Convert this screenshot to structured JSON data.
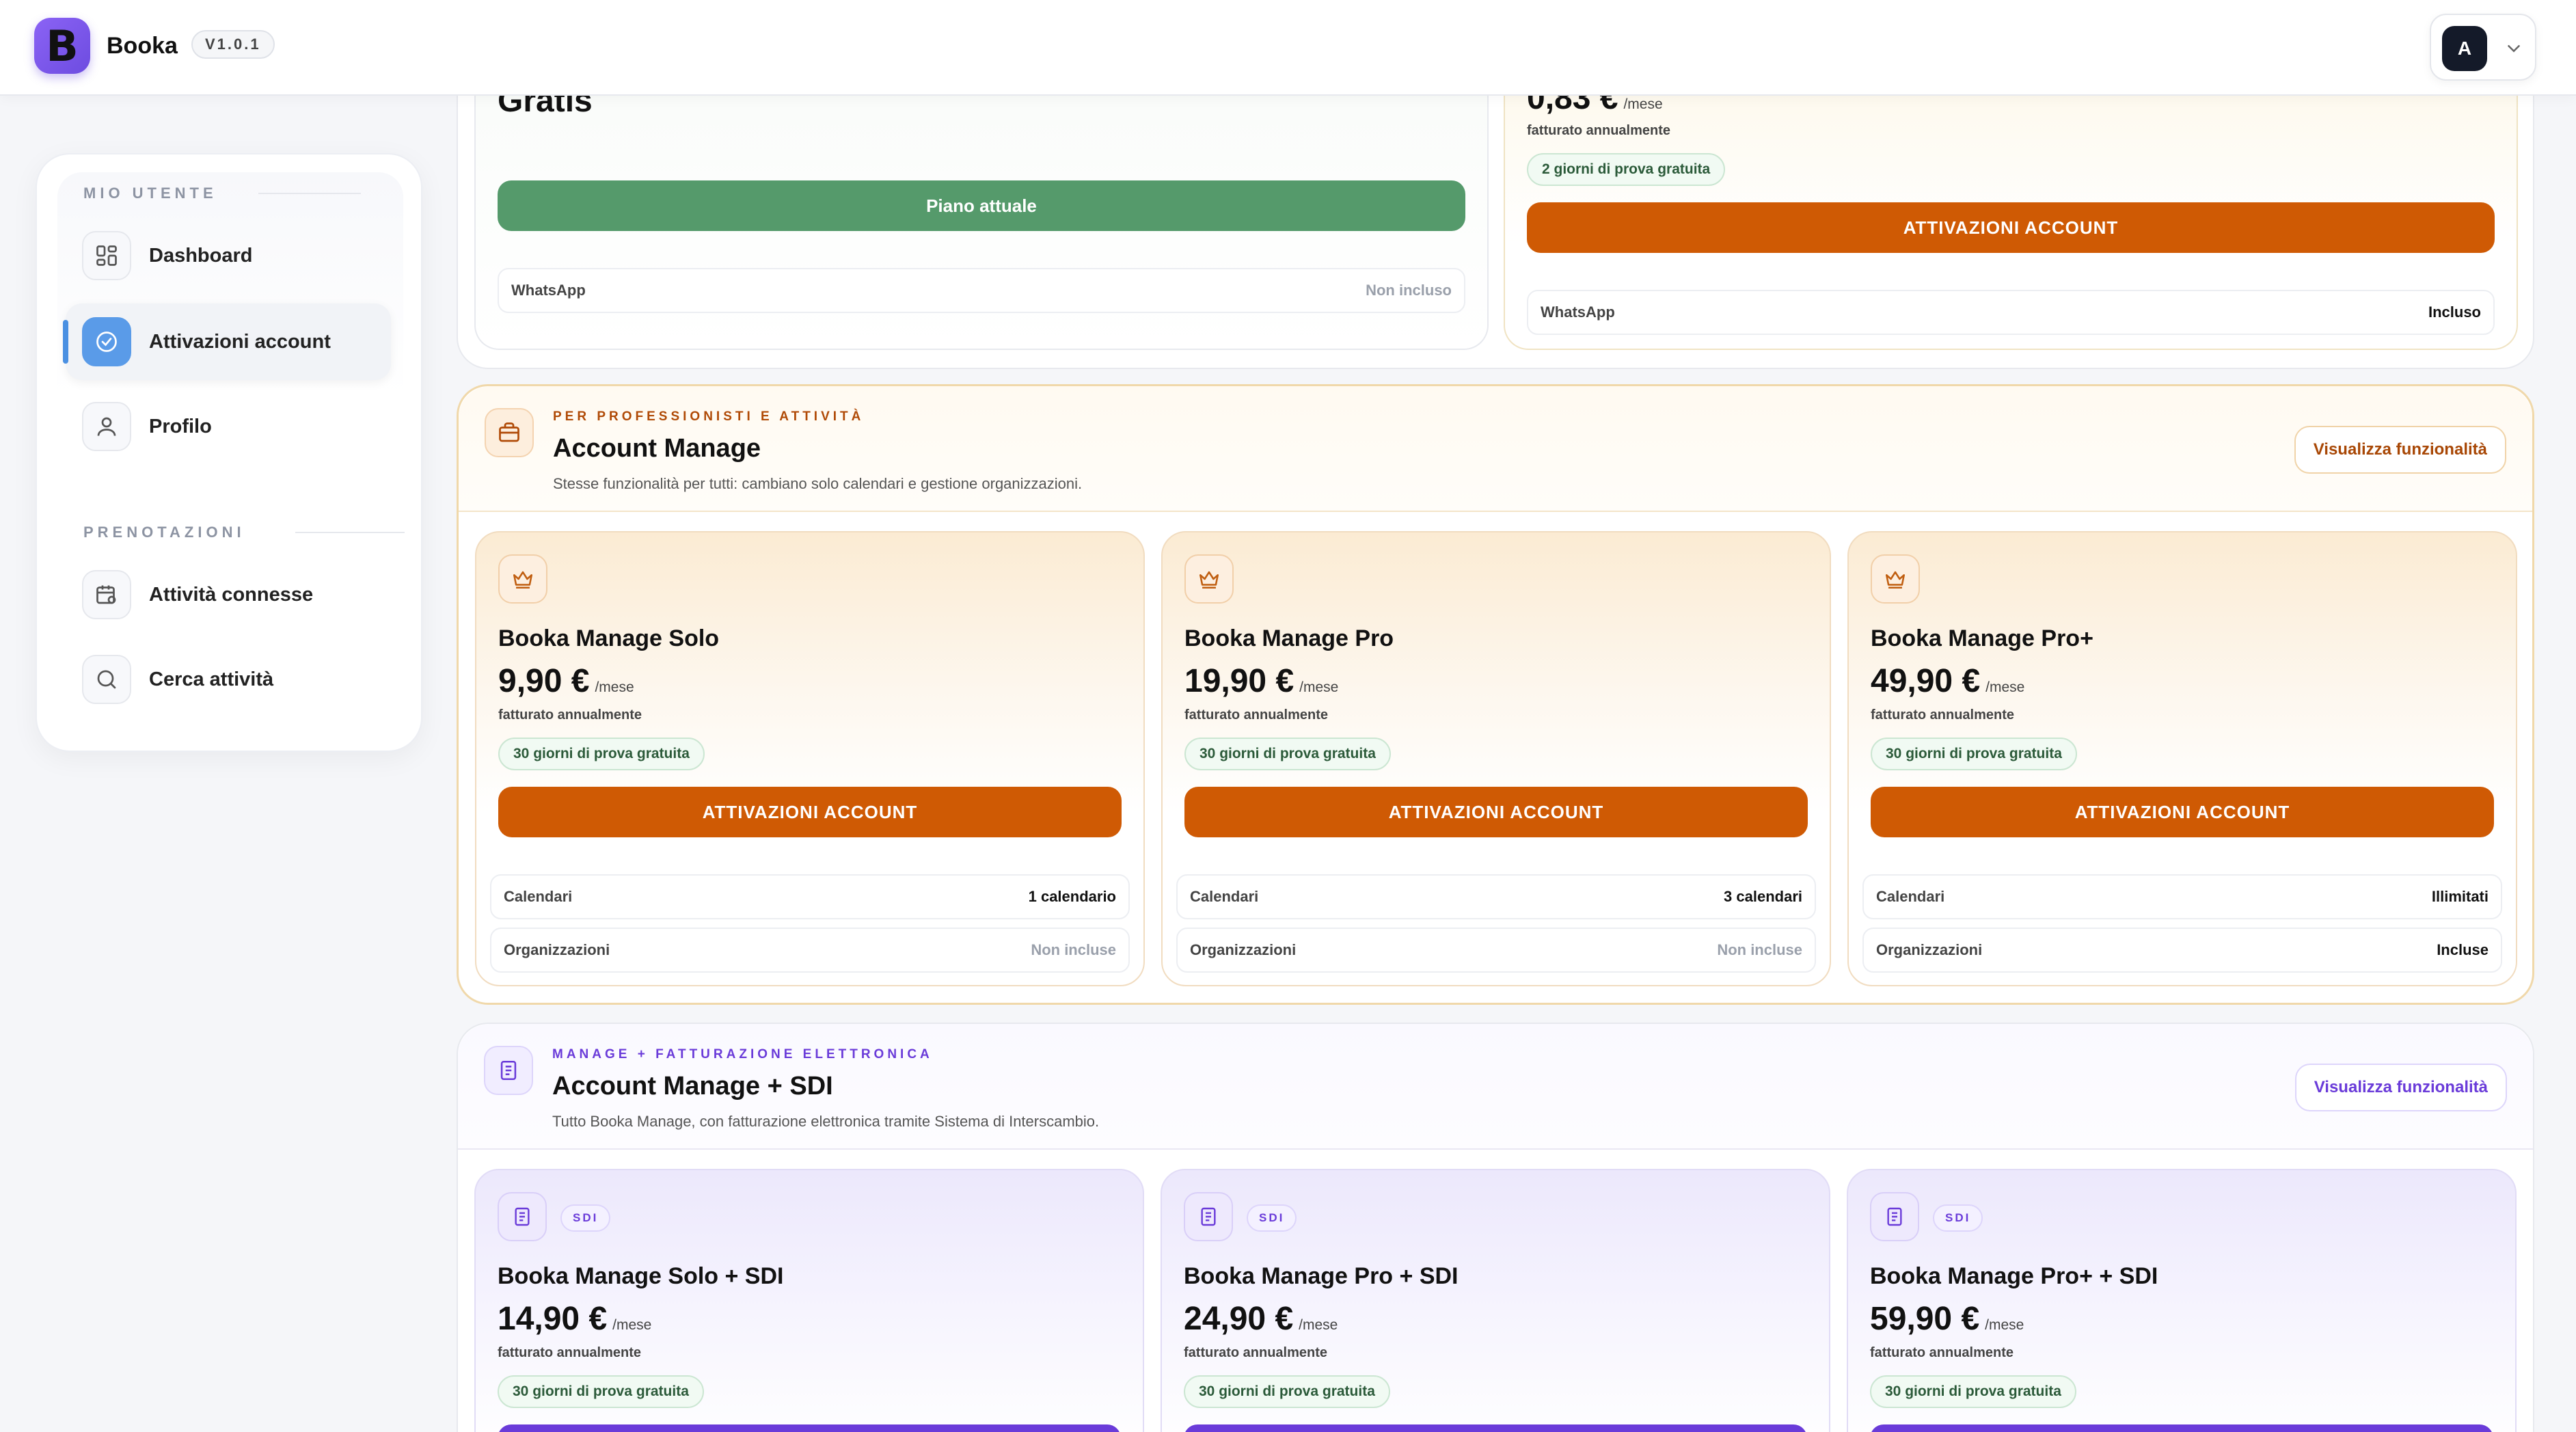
{
  "app": {
    "name": "Booka",
    "version": "V1.0.1",
    "logo_letter": "B"
  },
  "user": {
    "avatar_initial": "A"
  },
  "sidebar": {
    "section_user": "MIO UTENTE",
    "section_bookings": "PRENOTAZIONI",
    "items": [
      {
        "label": "Dashboard",
        "icon": "grid-icon"
      },
      {
        "label": "Attivazioni account",
        "icon": "check-circle-icon",
        "active": true
      },
      {
        "label": "Profilo",
        "icon": "user-icon"
      },
      {
        "label": "Attività connesse",
        "icon": "calendar-link-icon"
      },
      {
        "label": "Cerca attività",
        "icon": "search-icon"
      }
    ]
  },
  "top_plans": {
    "free": {
      "title": "Gratis",
      "button": "Piano attuale",
      "feature": {
        "key": "WhatsApp",
        "value": "Non incluso"
      }
    },
    "paid": {
      "price": "0,83 €",
      "per": "/mese",
      "billing": "fatturato annualmente",
      "trial": "2 giorni di prova gratuita",
      "button": "ATTIVAZIONI ACCOUNT",
      "feature": {
        "key": "WhatsApp",
        "value": "Incluso"
      }
    }
  },
  "manage": {
    "eyebrow": "PER PROFESSIONISTI E ATTIVITÀ",
    "title": "Account Manage",
    "desc": "Stesse funzionalità per tutti: cambiano solo calendari e gestione organizzazioni.",
    "view_button": "Visualizza funzionalità",
    "plans": [
      {
        "name": "Booka Manage Solo",
        "price": "9,90 €",
        "per": "/mese",
        "billing": "fatturato annualmente",
        "trial": "30 giorni di prova gratuita",
        "button": "ATTIVAZIONI ACCOUNT",
        "features": [
          {
            "key": "Calendari",
            "value": "1 calendario",
            "muted": false
          },
          {
            "key": "Organizzazioni",
            "value": "Non incluse",
            "muted": true
          }
        ]
      },
      {
        "name": "Booka Manage Pro",
        "price": "19,90 €",
        "per": "/mese",
        "billing": "fatturato annualmente",
        "trial": "30 giorni di prova gratuita",
        "button": "ATTIVAZIONI ACCOUNT",
        "features": [
          {
            "key": "Calendari",
            "value": "3 calendari",
            "muted": false
          },
          {
            "key": "Organizzazioni",
            "value": "Non incluse",
            "muted": true
          }
        ]
      },
      {
        "name": "Booka Manage Pro+",
        "price": "49,90 €",
        "per": "/mese",
        "billing": "fatturato annualmente",
        "trial": "30 giorni di prova gratuita",
        "button": "ATTIVAZIONI ACCOUNT",
        "features": [
          {
            "key": "Calendari",
            "value": "Illimitati",
            "muted": false
          },
          {
            "key": "Organizzazioni",
            "value": "Incluse",
            "muted": false
          }
        ]
      }
    ]
  },
  "sdi": {
    "eyebrow": "MANAGE + FATTURAZIONE ELETTRONICA",
    "title": "Account Manage + SDI",
    "desc": "Tutto Booka Manage, con fatturazione elettronica tramite Sistema di Interscambio.",
    "view_button": "Visualizza funzionalità",
    "badge": "SDI",
    "plans": [
      {
        "name": "Booka Manage Solo + SDI",
        "price": "14,90 €",
        "per": "/mese",
        "billing": "fatturato annualmente",
        "trial": "30 giorni di prova gratuita"
      },
      {
        "name": "Booka Manage Pro + SDI",
        "price": "24,90 €",
        "per": "/mese",
        "billing": "fatturato annualmente",
        "trial": "30 giorni di prova gratuita"
      },
      {
        "name": "Booka Manage Pro+ + SDI",
        "price": "59,90 €",
        "per": "/mese",
        "billing": "fatturato annualmente",
        "trial": "30 giorni di prova gratuita"
      }
    ]
  },
  "colors": {
    "accent_orange": "#cf5a04",
    "accent_purple": "#6a3bd9",
    "accent_green": "#559a6b",
    "accent_blue": "#5a9be8"
  }
}
